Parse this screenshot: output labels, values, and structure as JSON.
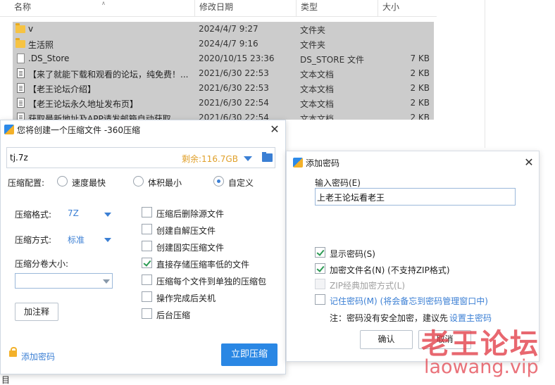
{
  "explorer": {
    "columns": {
      "name": "名称",
      "date": "修改日期",
      "type": "类型",
      "size": "大小"
    },
    "rows": [
      {
        "name": "v",
        "date": "2024/4/7 9:27",
        "type": "文件夹",
        "size": "",
        "icon": "folder-icon"
      },
      {
        "name": "生活照",
        "date": "2024/4/7 9:16",
        "type": "文件夹",
        "size": "",
        "icon": "folder-icon"
      },
      {
        "name": ".DS_Store",
        "date": "2020/10/15 23:36",
        "type": "DS_STORE 文件",
        "size": "7 KB",
        "icon": "file-icon"
      },
      {
        "name": "【来了就能下载和观看的论坛，纯免费！...",
        "date": "2021/6/30 22:53",
        "type": "文本文档",
        "size": "2 KB",
        "icon": "text-document-icon"
      },
      {
        "name": "【老王论坛介绍】",
        "date": "2021/6/30 22:53",
        "type": "文本文档",
        "size": "2 KB",
        "icon": "text-document-icon"
      },
      {
        "name": "【老王论坛永久地址发布页】",
        "date": "2021/6/30 22:54",
        "type": "文本文档",
        "size": "2 KB",
        "icon": "text-document-icon"
      },
      {
        "name": "获取最新地址及APP请发邮箱自动获取",
        "date": "2021/6/30 22:54",
        "type": "文本文档",
        "size": "2 KB",
        "icon": "text-document-icon"
      }
    ],
    "bottom_char": "目"
  },
  "compress_dialog": {
    "title": "您将创建一个压缩文件 -360压缩",
    "path_value": "tj.7z",
    "free_space": "剩余:116.7GB",
    "config_label": "压缩配置:",
    "radio_options": [
      "速度最快",
      "体积最小",
      "自定义"
    ],
    "selected_radio": "自定义",
    "format_label": "压缩格式:",
    "format_value": "7Z",
    "method_label": "压缩方式:",
    "method_value": "标准",
    "volume_label": "压缩分卷大小:",
    "volume_value": "",
    "comment_button": "加注释",
    "options": [
      {
        "label": "压缩后删除源文件",
        "checked": false
      },
      {
        "label": "创建自解压文件",
        "checked": false
      },
      {
        "label": "创建固实压缩文件",
        "checked": false
      },
      {
        "label": "直接存储压缩率低的文件",
        "checked": true
      },
      {
        "label": "压缩每个文件到单独的压缩包",
        "checked": false
      },
      {
        "label": "操作完成后关机",
        "checked": false
      },
      {
        "label": "后台压缩",
        "checked": false
      }
    ],
    "add_password_link": "添加密码",
    "compress_button": "立即压缩"
  },
  "password_dialog": {
    "title": "添加密码",
    "input_label": "输入密码(E)",
    "password_value": "上老王论坛看老王",
    "show_password": {
      "label": "显示密码(S)",
      "checked": true
    },
    "encrypt_names": {
      "label": "加密文件名(N) (不支持ZIP格式)",
      "checked": true
    },
    "zip_classic": {
      "label": "ZIP经典加密方式(L)",
      "checked": false,
      "disabled": true
    },
    "remember": {
      "label": "记住密码(M) (将会备忘到密码管理窗口中)",
      "checked": false
    },
    "note_prefix": "注：密码没有安全加密，建议先",
    "note_link": "设置主密码",
    "ok_button": "确认",
    "cancel_button": "取消"
  },
  "watermark": {
    "cn": "老王论坛",
    "en": "laowang.vip"
  },
  "colors": {
    "accent": "#2a87e4",
    "selection": "#cccccc",
    "check": "#2b9a53",
    "free_space": "#e0a02a",
    "watermark": "#e23c46"
  }
}
